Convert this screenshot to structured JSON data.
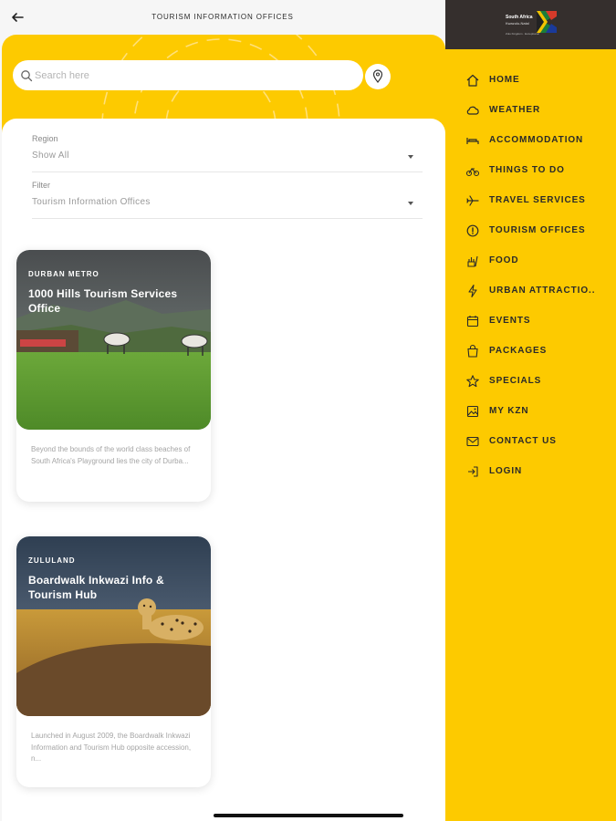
{
  "header": {
    "title": "TOURISM INFORMATION OFFICES"
  },
  "search": {
    "placeholder": "Search here",
    "value": ""
  },
  "filters": {
    "region": {
      "label": "Region",
      "value": "Show All"
    },
    "filter": {
      "label": "Filter",
      "value": "Tourism Information Offices"
    }
  },
  "cards": [
    {
      "region": "DURBAN METRO",
      "title": "1000 Hills Tourism Services Office",
      "description": "Beyond the bounds of the world class beaches of South Africa's Playground lies the city of Durba..."
    },
    {
      "region": "ZULULAND",
      "title": "Boardwalk Inkwazi Info & Tourism Hub",
      "description": "Launched in August 2009, the Boardwalk Inkwazi Information and Tourism Hub opposite accession, n..."
    }
  ],
  "drawer": {
    "logo_text": [
      "South Africa",
      "Kwazulu-Natal",
      "Zulu Kingdom · Exceptional"
    ],
    "items": [
      {
        "label": "HOME",
        "icon": "home-icon"
      },
      {
        "label": "WEATHER",
        "icon": "cloud-icon"
      },
      {
        "label": "ACCOMMODATION",
        "icon": "bed-icon"
      },
      {
        "label": "THINGS TO DO",
        "icon": "bicycle-icon"
      },
      {
        "label": "TRAVEL SERVICES",
        "icon": "plane-icon"
      },
      {
        "label": "TOURISM OFFICES",
        "icon": "info-icon"
      },
      {
        "label": "FOOD",
        "icon": "food-icon"
      },
      {
        "label": "URBAN ATTRACTIO..",
        "icon": "lightning-icon"
      },
      {
        "label": "EVENTS",
        "icon": "calendar-icon"
      },
      {
        "label": "PACKAGES",
        "icon": "bag-icon"
      },
      {
        "label": "SPECIALS",
        "icon": "star-icon"
      },
      {
        "label": "MY KZN",
        "icon": "photo-icon"
      },
      {
        "label": "CONTACT US",
        "icon": "mail-icon"
      },
      {
        "label": "LOGIN",
        "icon": "login-icon"
      }
    ]
  },
  "colors": {
    "accent": "#fdca00",
    "drawer_header": "#352f2d",
    "text_dark": "#2a2a2a"
  }
}
